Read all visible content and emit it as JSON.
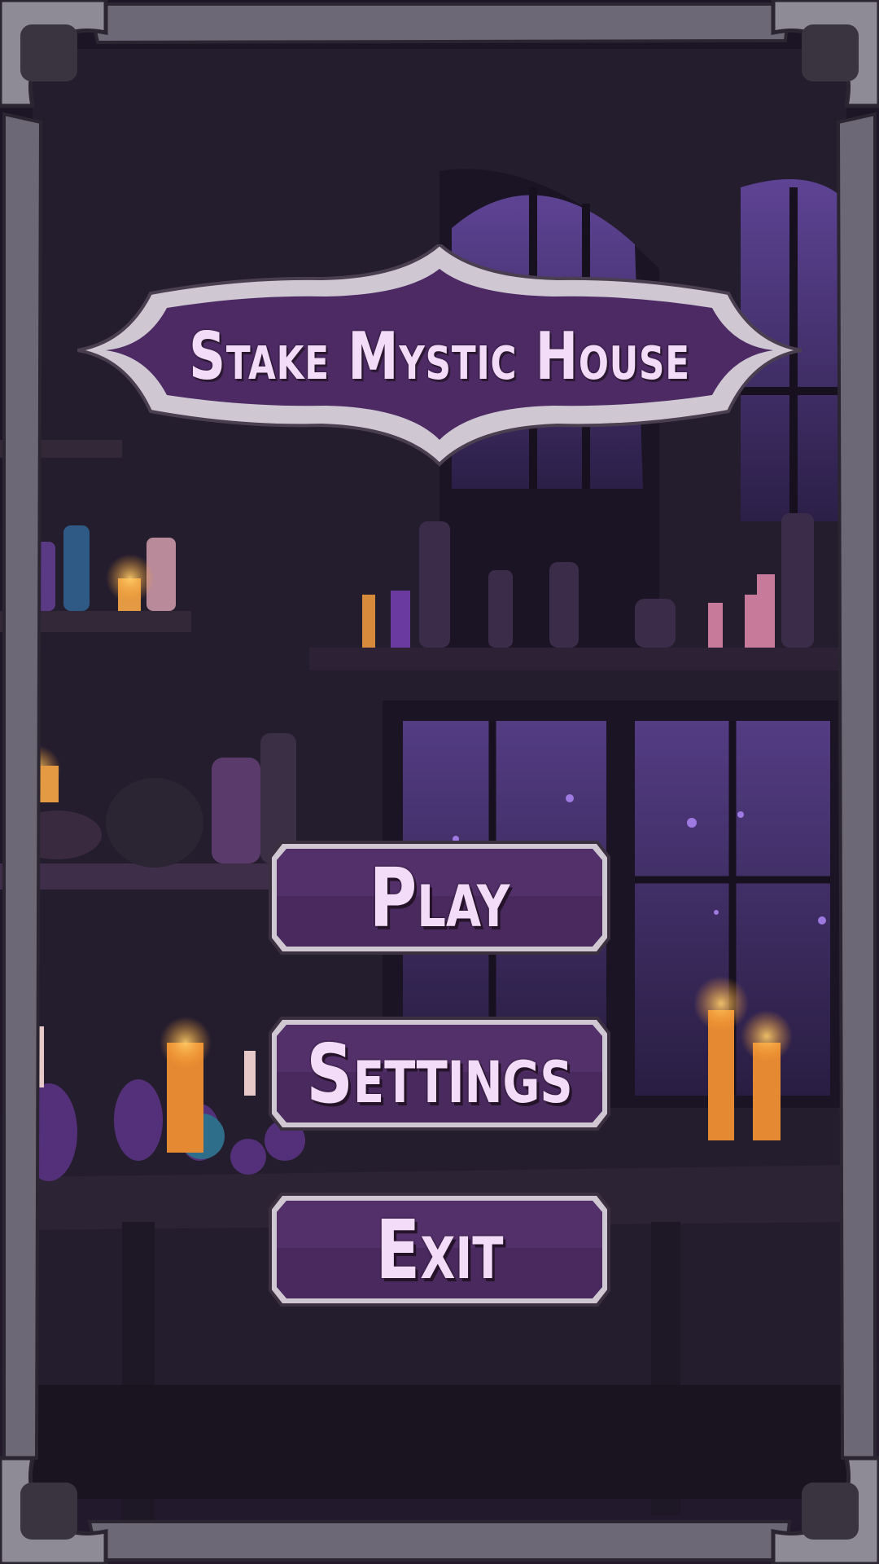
{
  "game": {
    "title": "Stake Mystic House"
  },
  "menu": {
    "play_label": "Play",
    "settings_label": "Settings",
    "exit_label": "Exit"
  },
  "colors": {
    "plaque_purple": "#4d2a64",
    "border_silver": "#cfc8d2",
    "text_lilac": "#f3dcf7",
    "candle_orange": "#e8902c"
  }
}
